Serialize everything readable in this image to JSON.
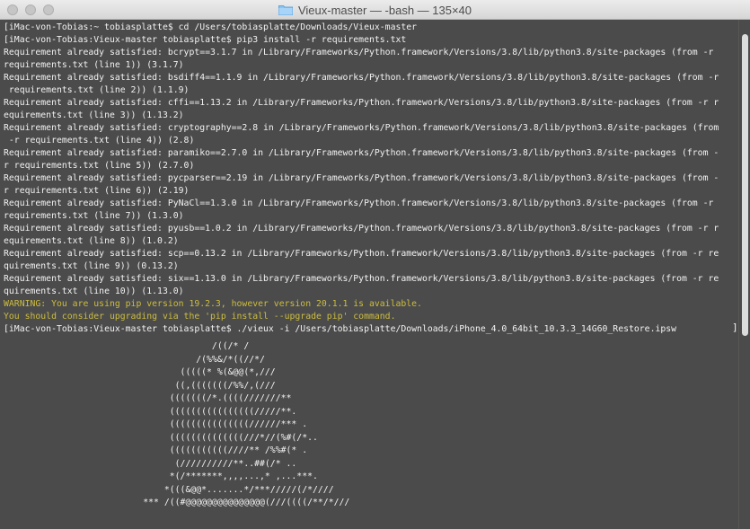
{
  "window": {
    "title": "Vieux-master — -bash — 135×40",
    "folder_icon": "folder-icon"
  },
  "terminal": {
    "lines": [
      {
        "text": "[iMac-von-Tobias:~ tobiasplatte$ cd /Users/tobiasplatte/Downloads/Vieux-master",
        "style": "normal"
      },
      {
        "text": "[iMac-von-Tobias:Vieux-master tobiasplatte$ pip3 install -r requirements.txt",
        "style": "normal"
      },
      {
        "text": "Requirement already satisfied: bcrypt==3.1.7 in /Library/Frameworks/Python.framework/Versions/3.8/lib/python3.8/site-packages (from -r",
        "style": "normal"
      },
      {
        "text": "requirements.txt (line 1)) (3.1.7)",
        "style": "normal"
      },
      {
        "text": "Requirement already satisfied: bsdiff4==1.1.9 in /Library/Frameworks/Python.framework/Versions/3.8/lib/python3.8/site-packages (from -r",
        "style": "normal"
      },
      {
        "text": " requirements.txt (line 2)) (1.1.9)",
        "style": "normal"
      },
      {
        "text": "Requirement already satisfied: cffi==1.13.2 in /Library/Frameworks/Python.framework/Versions/3.8/lib/python3.8/site-packages (from -r r",
        "style": "normal"
      },
      {
        "text": "equirements.txt (line 3)) (1.13.2)",
        "style": "normal"
      },
      {
        "text": "Requirement already satisfied: cryptography==2.8 in /Library/Frameworks/Python.framework/Versions/3.8/lib/python3.8/site-packages (from",
        "style": "normal"
      },
      {
        "text": " -r requirements.txt (line 4)) (2.8)",
        "style": "normal"
      },
      {
        "text": "Requirement already satisfied: paramiko==2.7.0 in /Library/Frameworks/Python.framework/Versions/3.8/lib/python3.8/site-packages (from -",
        "style": "normal"
      },
      {
        "text": "r requirements.txt (line 5)) (2.7.0)",
        "style": "normal"
      },
      {
        "text": "Requirement already satisfied: pycparser==2.19 in /Library/Frameworks/Python.framework/Versions/3.8/lib/python3.8/site-packages (from -",
        "style": "normal"
      },
      {
        "text": "r requirements.txt (line 6)) (2.19)",
        "style": "normal"
      },
      {
        "text": "Requirement already satisfied: PyNaCl==1.3.0 in /Library/Frameworks/Python.framework/Versions/3.8/lib/python3.8/site-packages (from -r",
        "style": "normal"
      },
      {
        "text": "requirements.txt (line 7)) (1.3.0)",
        "style": "normal"
      },
      {
        "text": "Requirement already satisfied: pyusb==1.0.2 in /Library/Frameworks/Python.framework/Versions/3.8/lib/python3.8/site-packages (from -r r",
        "style": "normal"
      },
      {
        "text": "equirements.txt (line 8)) (1.0.2)",
        "style": "normal"
      },
      {
        "text": "Requirement already satisfied: scp==0.13.2 in /Library/Frameworks/Python.framework/Versions/3.8/lib/python3.8/site-packages (from -r re",
        "style": "normal"
      },
      {
        "text": "quirements.txt (line 9)) (0.13.2)",
        "style": "normal"
      },
      {
        "text": "Requirement already satisfied: six==1.13.0 in /Library/Frameworks/Python.framework/Versions/3.8/lib/python3.8/site-packages (from -r re",
        "style": "normal"
      },
      {
        "text": "quirements.txt (line 10)) (1.13.0)",
        "style": "normal"
      },
      {
        "text": "WARNING: You are using pip version 19.2.3, however version 20.1.1 is available.",
        "style": "warn"
      },
      {
        "text": "You should consider upgrading via the 'pip install --upgrade pip' command.",
        "style": "warn"
      },
      {
        "text": "[iMac-von-Tobias:Vieux-master tobiasplatte$ ./vieux -i /Users/tobiasplatte/Downloads/iPhone_4.0_64bit_10.3.3_14G60_Restore.ipsw",
        "style": "normal"
      }
    ],
    "ascii_art": [
      "                                        /((/* /",
      "                                     /(%%&/*((//*/",
      "                                  (((((* %(&@@(*,///",
      "                                 ((,(((((((/%%/,(///",
      "                                (((((((/*.((((///////**",
      "                                ((((((((((((((((/////**.",
      "                                (((((((((((((((//////*** .",
      "                                ((((((((((((((///*//(%#(/*..",
      "                                (((((((((((////** /%%#(* .",
      "                                 (//////////**..##(/* ..",
      "                                *(/*******,,,,...,* ,...***.",
      "                               *(((&@@*.......*/***/////(/*////",
      "                           *** /((#@@@@@@@@@@@@@@@(///((((/**/*///"
    ],
    "colors": {
      "background": "#4b4b4b",
      "text": "#f2f2f2",
      "warning": "#cdbd3f"
    }
  }
}
